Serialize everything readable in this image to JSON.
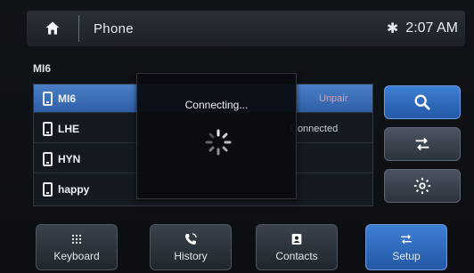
{
  "header": {
    "title": "Phone",
    "time": "2:07 AM",
    "home_icon": "home-icon",
    "bluetooth_icon": "bluetooth-icon"
  },
  "devices": {
    "section_label": "MI6",
    "items": [
      {
        "label": "MI6",
        "selected": true,
        "aux": "Unpair"
      },
      {
        "label": "LHE",
        "selected": false,
        "aux": "Connected"
      },
      {
        "label": "HYN",
        "selected": false,
        "aux": ""
      },
      {
        "label": "happy",
        "selected": false,
        "aux": ""
      }
    ]
  },
  "modal": {
    "message": "Connecting..."
  },
  "side_controls": [
    {
      "name": "search",
      "icon": "search-icon",
      "active": true
    },
    {
      "name": "swap",
      "icon": "swap-icon",
      "active": false
    },
    {
      "name": "settings",
      "icon": "gear-icon",
      "active": false
    }
  ],
  "bottom_nav": [
    {
      "label": "Keyboard",
      "icon": "keypad-icon",
      "active": false
    },
    {
      "label": "History",
      "icon": "call-history-icon",
      "active": false
    },
    {
      "label": "Contacts",
      "icon": "contacts-icon",
      "active": false
    },
    {
      "label": "Setup",
      "icon": "swap-icon",
      "active": true
    }
  ],
  "colors": {
    "accent": "#2f5fa6",
    "background": "#0d0f12"
  }
}
